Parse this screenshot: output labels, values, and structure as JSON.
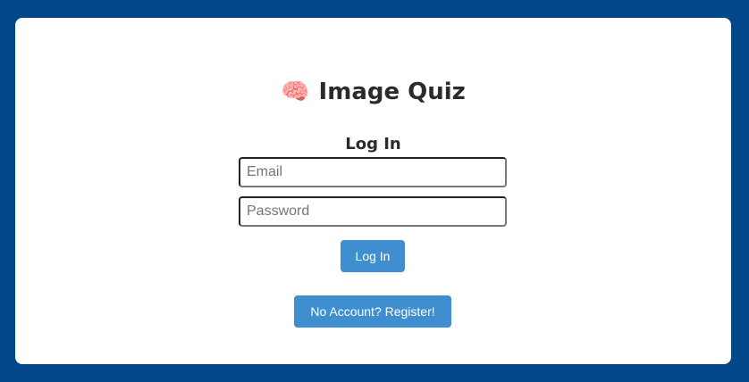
{
  "header": {
    "title": "Image Quiz",
    "icon": "brain-icon",
    "icon_glyph": "🧠"
  },
  "form": {
    "heading": "Log In",
    "email_placeholder": "Email",
    "password_placeholder": "Password",
    "login_label": "Log In",
    "register_label": "No Account? Register!"
  },
  "colors": {
    "background": "#01478a",
    "button": "#3f8fd0"
  }
}
